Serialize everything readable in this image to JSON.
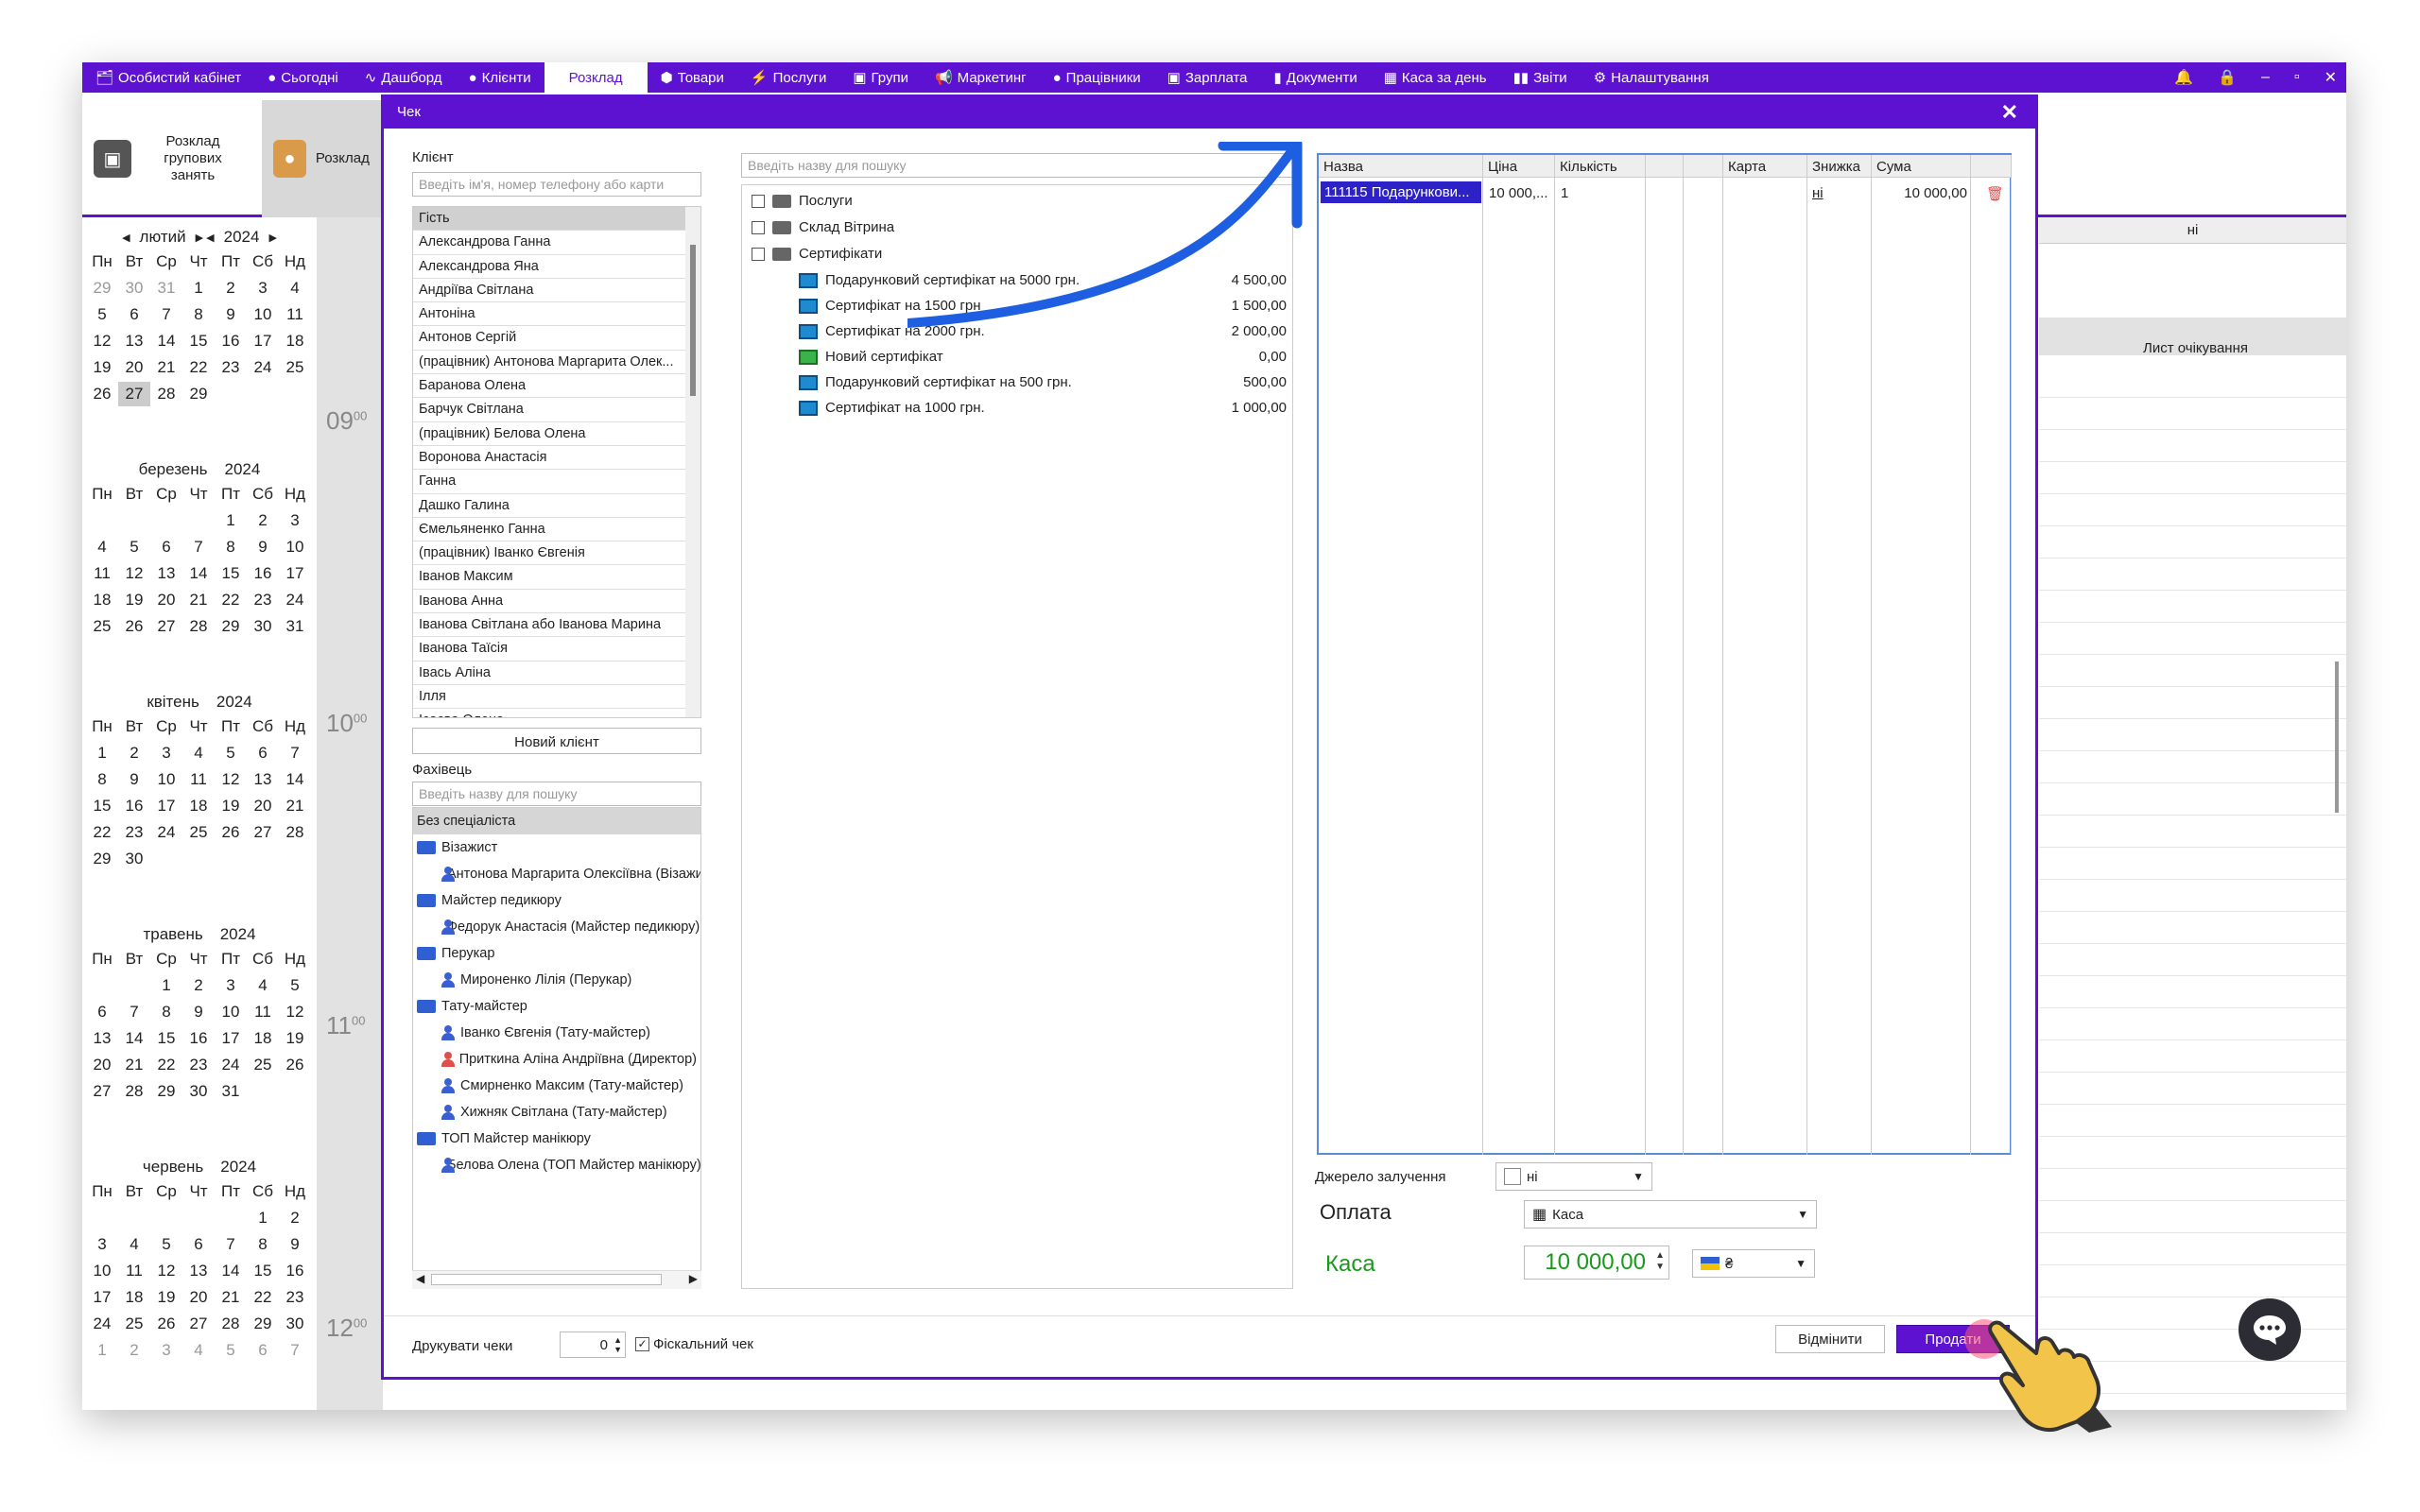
{
  "nav": {
    "items": [
      {
        "icon": "cabinet-icon",
        "glyph": "🗂",
        "label": "Особистий кабінет"
      },
      {
        "icon": "today-icon",
        "glyph": "●",
        "label": "Сьогодні"
      },
      {
        "icon": "dashboard-icon",
        "glyph": "∿",
        "label": "Дашборд"
      },
      {
        "icon": "clients-icon",
        "glyph": "●",
        "label": "Клієнти"
      },
      {
        "icon": "",
        "glyph": "",
        "label": "Розклад"
      },
      {
        "icon": "goods-icon",
        "glyph": "⬢",
        "label": "Товари"
      },
      {
        "icon": "services-icon",
        "glyph": "⚡",
        "label": "Послуги"
      },
      {
        "icon": "groups-icon",
        "glyph": "▣",
        "label": "Групи"
      },
      {
        "icon": "marketing-icon",
        "glyph": "📢",
        "label": "Маркетинг"
      },
      {
        "icon": "staff-icon",
        "glyph": "●",
        "label": "Працівники"
      },
      {
        "icon": "salary-icon",
        "glyph": "▣",
        "label": "Зарплата"
      },
      {
        "icon": "documents-icon",
        "glyph": "▮",
        "label": "Документи"
      },
      {
        "icon": "cash-icon",
        "glyph": "▦",
        "label": "Каса за день"
      },
      {
        "icon": "reports-icon",
        "glyph": "▮▮",
        "label": "Звіти"
      },
      {
        "icon": "settings-icon",
        "glyph": "⚙",
        "label": "Налаштування"
      }
    ],
    "active": "Розклад"
  },
  "ribbon": {
    "group_schedule": "Розклад групових занять",
    "specialist_schedule": "Розклад Фахівці н"
  },
  "calendar": {
    "weekdays": [
      "Пн",
      "Вт",
      "Ср",
      "Чт",
      "Пт",
      "Сб",
      "Нд"
    ],
    "months": [
      {
        "name": "лютий",
        "year": "2024",
        "days": [
          "29",
          "30",
          "31",
          "1",
          "2",
          "3",
          "4",
          "5",
          "6",
          "7",
          "8",
          "9",
          "10",
          "11",
          "12",
          "13",
          "14",
          "15",
          "16",
          "17",
          "18",
          "19",
          "20",
          "21",
          "22",
          "23",
          "24",
          "25",
          "26",
          "27",
          "28",
          "29"
        ]
      },
      {
        "name": "березень",
        "year": "2024",
        "days": [
          "",
          "",
          "",
          "",
          "1",
          "2",
          "3",
          "4",
          "5",
          "6",
          "7",
          "8",
          "9",
          "10",
          "11",
          "12",
          "13",
          "14",
          "15",
          "16",
          "17",
          "18",
          "19",
          "20",
          "21",
          "22",
          "23",
          "24",
          "25",
          "26",
          "27",
          "28",
          "29",
          "30",
          "31"
        ]
      },
      {
        "name": "квітень",
        "year": "2024",
        "days": [
          "1",
          "2",
          "3",
          "4",
          "5",
          "6",
          "7",
          "8",
          "9",
          "10",
          "11",
          "12",
          "13",
          "14",
          "15",
          "16",
          "17",
          "18",
          "19",
          "20",
          "21",
          "22",
          "23",
          "24",
          "25",
          "26",
          "27",
          "28",
          "29",
          "30"
        ]
      },
      {
        "name": "травень",
        "year": "2024",
        "days": [
          "",
          "",
          "1",
          "2",
          "3",
          "4",
          "5",
          "6",
          "7",
          "8",
          "9",
          "10",
          "11",
          "12",
          "13",
          "14",
          "15",
          "16",
          "17",
          "18",
          "19",
          "20",
          "21",
          "22",
          "23",
          "24",
          "25",
          "26",
          "27",
          "28",
          "29",
          "30",
          "31"
        ]
      },
      {
        "name": "червень",
        "year": "2024",
        "days": [
          "",
          "",
          "",
          "",
          "",
          "1",
          "2",
          "3",
          "4",
          "5",
          "6",
          "7",
          "8",
          "9",
          "10",
          "11",
          "12",
          "13",
          "14",
          "15",
          "16",
          "17",
          "18",
          "19",
          "20",
          "21",
          "22",
          "23",
          "24",
          "25",
          "26",
          "27",
          "28",
          "29",
          "30",
          "1",
          "2",
          "3",
          "4",
          "5",
          "6",
          "7"
        ]
      }
    ],
    "times": [
      "09",
      "10",
      "11",
      "12"
    ],
    "minutes": "00"
  },
  "right_panel": {
    "header": "ні",
    "wait_list": "Лист очікування"
  },
  "dialog": {
    "title": "Чек",
    "client_label": "Клієнт",
    "client_placeholder": "Введіть ім'я, номер телефону або карти",
    "clients": [
      "Гість",
      "Александрова Ганна",
      "Александрова Яна",
      "Андріїва Світлана",
      "Антоніна",
      "Антонов Сергій",
      "(працівник) Антонова Маргарита Олек...",
      "Баранова Олена",
      "Барчук Світлана",
      "(працівник) Белова Олена",
      "Воронова Анастасія",
      "Ганна",
      "Дашко Галина",
      "Ємельяненко Ганна",
      "(працівник) Іванко Євгенія",
      "Іванов Максим",
      "Іванова Анна",
      "Іванова Світлана або Іванова Марина",
      "Іванова Таїсія",
      "Івась Аліна",
      "Ілля",
      "Ісаєва Олена"
    ],
    "new_client": "Новий клієнт",
    "specialist_label": "Фахівець",
    "specialist_placeholder": "Введіть назву для пошуку",
    "specialists": [
      {
        "type": "none",
        "label": "Без спеціаліста"
      },
      {
        "type": "folder",
        "label": "Візажист"
      },
      {
        "type": "person",
        "label": "Антонова Маргарита Олексіївна (Візажист)"
      },
      {
        "type": "folder",
        "label": "Майстер педикюру"
      },
      {
        "type": "person",
        "label": "Федорук Анастасія (Майстер педикюру)"
      },
      {
        "type": "folder",
        "label": "Перукар"
      },
      {
        "type": "person",
        "label": "Мироненко Лілія (Перукар)"
      },
      {
        "type": "folder",
        "label": "Тату-майстер"
      },
      {
        "type": "person",
        "label": "Іванко Євгенія (Тату-майстер)"
      },
      {
        "type": "person-red",
        "label": "Приткина Аліна Андріївна (Директор)"
      },
      {
        "type": "person",
        "label": "Смирненко Максим (Тату-майстер)"
      },
      {
        "type": "person",
        "label": "Хижняк Світлана (Тату-майстер)"
      },
      {
        "type": "folder",
        "label": "ТОП Майстер манікюру"
      },
      {
        "type": "person",
        "label": "Белова Олена (ТОП Майстер манікюру)"
      }
    ],
    "product_search_placeholder": "Введіть назву для пошуку",
    "tree_groups": [
      "Послуги",
      "Склад Вітрина",
      "Сертифікати"
    ],
    "certificates": [
      {
        "name": "Подарунковий сертифікат на 5000 грн.",
        "price": "4 500,00",
        "icon": "cert"
      },
      {
        "name": "Сертифікат на 1500 грн",
        "price": "1 500,00",
        "icon": "cert"
      },
      {
        "name": "Сертифікат на 2000 грн.",
        "price": "2 000,00",
        "icon": "cert"
      },
      {
        "name": "Новий сертифікат",
        "price": "0,00",
        "icon": "cert-green"
      },
      {
        "name": "Подарунковий сертифікат на 500 грн.",
        "price": "500,00",
        "icon": "cert"
      },
      {
        "name": "Сертифікат на 1000 грн.",
        "price": "1 000,00",
        "icon": "cert"
      }
    ],
    "check_columns": [
      "Назва",
      "Ціна",
      "Кількість",
      "",
      "",
      "Карта",
      "Знижка",
      "Сума",
      ""
    ],
    "check_row": {
      "name": "111115 Подарункови...",
      "price": "10 000,...",
      "qty": "1",
      "discount": "ні",
      "sum": "10 000,00"
    },
    "source_label": "Джерело залучення",
    "source_value": "ні",
    "payment_label": "Оплата",
    "payment_value": "Каса",
    "cash_label": "Каса",
    "cash_amount": "10 000,00",
    "currency": "₴",
    "print_label": "Друкувати чеки",
    "print_count": "0",
    "fiscal_label": "Фіскальний чек",
    "cancel": "Відмінити",
    "sell": "Продати"
  },
  "colors": {
    "brand": "#5d12d2",
    "cash_green": "#1a9a1a",
    "arrow": "#1d5fe0"
  }
}
